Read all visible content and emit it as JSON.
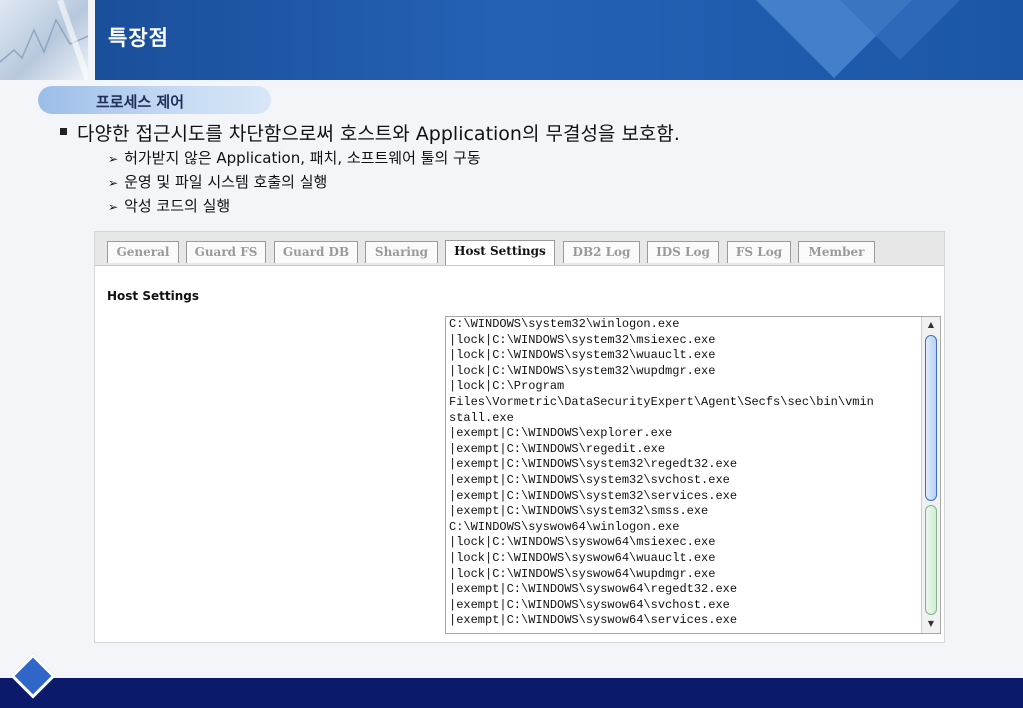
{
  "header": {
    "title": "특장점"
  },
  "section": {
    "label": "프로세스 제어"
  },
  "bullet": "다양한 접근시도를 차단함으로써 호스트와 Application의 무결성을 보호함.",
  "sub_bullets": [
    "허가받지 않은 Application, 패치, 소프트웨어 툴의 구동",
    "운영 및 파일 시스템 호출의 실행",
    "악성 코드의 실행"
  ],
  "tabs": [
    "General",
    "Guard FS",
    "Guard DB",
    "Sharing",
    "Host Settings",
    "DB2 Log",
    "IDS Log",
    "FS Log",
    "Member"
  ],
  "active_tab": "Host Settings",
  "panel": {
    "label": "Host Settings"
  },
  "host_settings_lines": [
    "C:\\WINDOWS\\system32\\winlogon.exe",
    "|lock|C:\\WINDOWS\\system32\\msiexec.exe",
    "|lock|C:\\WINDOWS\\system32\\wuauclt.exe",
    "|lock|C:\\WINDOWS\\system32\\wupdmgr.exe",
    "|lock|C:\\Program",
    "Files\\Vormetric\\DataSecurityExpert\\Agent\\Secfs\\sec\\bin\\vmin",
    "stall.exe",
    "|exempt|C:\\WINDOWS\\explorer.exe",
    "|exempt|C:\\WINDOWS\\regedit.exe",
    "|exempt|C:\\WINDOWS\\system32\\regedt32.exe",
    "|exempt|C:\\WINDOWS\\system32\\svchost.exe",
    "|exempt|C:\\WINDOWS\\system32\\services.exe",
    "|exempt|C:\\WINDOWS\\system32\\smss.exe",
    "C:\\WINDOWS\\syswow64\\winlogon.exe",
    "|lock|C:\\WINDOWS\\syswow64\\msiexec.exe",
    "|lock|C:\\WINDOWS\\syswow64\\wuauclt.exe",
    "|lock|C:\\WINDOWS\\syswow64\\wupdmgr.exe",
    "|exempt|C:\\WINDOWS\\syswow64\\regedt32.exe",
    "|exempt|C:\\WINDOWS\\syswow64\\svchost.exe",
    "|exempt|C:\\WINDOWS\\syswow64\\services.exe"
  ],
  "icons": {
    "scroll_up": "scroll-up-arrow",
    "scroll_down": "scroll-down-arrow"
  },
  "colors": {
    "header_blue": "#1f5aa8",
    "footer_navy": "#0b1a6a",
    "pill_blue": "#a9c6ee"
  }
}
